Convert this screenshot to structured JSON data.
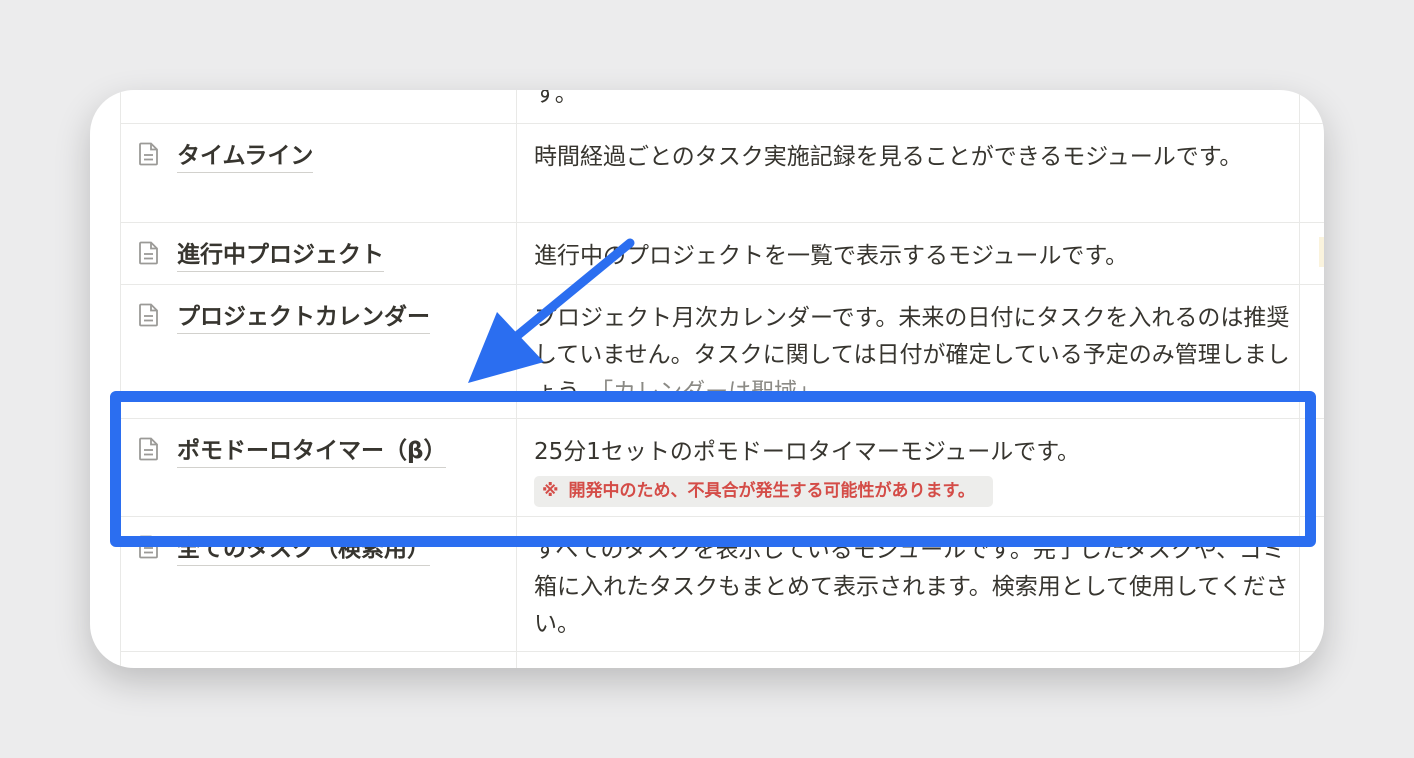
{
  "table": {
    "partial_top_text": "す。",
    "rows": [
      {
        "name": "タイムライン",
        "description": "時間経過ごとのタスク実施記録を見ることができるモジュールです。",
        "icon": "document-icon"
      },
      {
        "name": "進行中プロジェクト",
        "description": "進行中のプロジェクトを一覧で表示するモジュールです。",
        "icon": "document-icon"
      },
      {
        "name": "プロジェクトカレンダー",
        "description": "プロジェクト月次カレンダーです。未来の日付にタスクを入れるのは推奨していません。タスクに関しては日付が確定している予定のみ管理しましょう。",
        "link_text": "「カレンダーは聖域」",
        "icon": "document-icon"
      },
      {
        "name": "ポモドーロタイマー（β）",
        "description": "25分1セットのポモドーロタイマーモジュールです。",
        "warning_mark": "※",
        "warning": "開発中のため、不具合が発生する可能性があります。",
        "icon": "document-icon",
        "highlighted": true
      },
      {
        "name": "全てのタスク（検索用）",
        "description": "すべてのタスクを表示しているモジュールです。完了したタスクや、ゴミ箱に入れたタスクもまとめて表示されます。検索用として使用してください。",
        "icon": "document-icon"
      }
    ]
  },
  "annotation": {
    "highlight_color": "#2b6ef0",
    "arrow_color": "#2b6ef0"
  }
}
